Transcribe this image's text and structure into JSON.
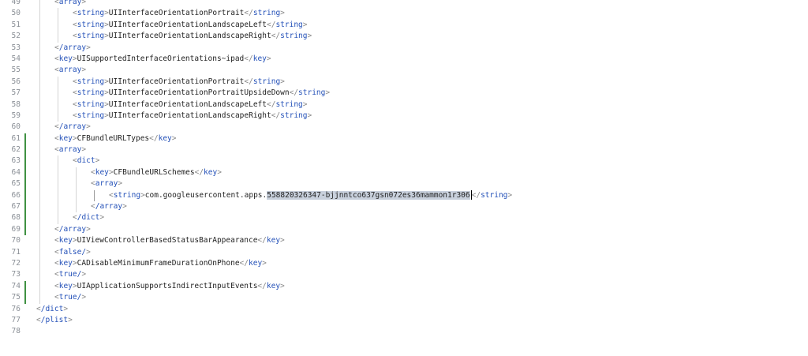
{
  "editor": {
    "lines": [
      {
        "number": "49",
        "indent": 1,
        "open": "array",
        "text": "",
        "close": "",
        "modified": false
      },
      {
        "number": "50",
        "indent": 2,
        "open": "string",
        "text": "UIInterfaceOrientationPortrait",
        "close": "string",
        "modified": false
      },
      {
        "number": "51",
        "indent": 2,
        "open": "string",
        "text": "UIInterfaceOrientationLandscapeLeft",
        "close": "string",
        "modified": false
      },
      {
        "number": "52",
        "indent": 2,
        "open": "string",
        "text": "UIInterfaceOrientationLandscapeRight",
        "close": "string",
        "modified": false
      },
      {
        "number": "53",
        "indent": 1,
        "open": "/array",
        "text": "",
        "close": "",
        "modified": false
      },
      {
        "number": "54",
        "indent": 1,
        "open": "key",
        "text": "UISupportedInterfaceOrientations~ipad",
        "close": "key",
        "modified": false
      },
      {
        "number": "55",
        "indent": 1,
        "open": "array",
        "text": "",
        "close": "",
        "modified": false
      },
      {
        "number": "56",
        "indent": 2,
        "open": "string",
        "text": "UIInterfaceOrientationPortrait",
        "close": "string",
        "modified": false
      },
      {
        "number": "57",
        "indent": 2,
        "open": "string",
        "text": "UIInterfaceOrientationPortraitUpsideDown",
        "close": "string",
        "modified": false
      },
      {
        "number": "58",
        "indent": 2,
        "open": "string",
        "text": "UIInterfaceOrientationLandscapeLeft",
        "close": "string",
        "modified": false
      },
      {
        "number": "59",
        "indent": 2,
        "open": "string",
        "text": "UIInterfaceOrientationLandscapeRight",
        "close": "string",
        "modified": false
      },
      {
        "number": "60",
        "indent": 1,
        "open": "/array",
        "text": "",
        "close": "",
        "modified": false
      },
      {
        "number": "61",
        "indent": 1,
        "open": "key",
        "text": "CFBundleURLTypes",
        "close": "key",
        "modified": true
      },
      {
        "number": "62",
        "indent": 1,
        "open": "array",
        "text": "",
        "close": "",
        "modified": true
      },
      {
        "number": "63",
        "indent": 2,
        "open": "dict",
        "text": "",
        "close": "",
        "modified": true
      },
      {
        "number": "64",
        "indent": 3,
        "open": "key",
        "text": "CFBundleURLSchemes",
        "close": "key",
        "modified": true
      },
      {
        "number": "65",
        "indent": 3,
        "open": "array",
        "text": "",
        "close": "",
        "modified": true
      },
      {
        "number": "66",
        "indent": 4,
        "open": "string",
        "text": "com.googleusercontent.apps.",
        "selected": "558820326347-bjjnntco637gsn072es36mammon1r306",
        "close": "string",
        "modified": true,
        "current": true
      },
      {
        "number": "67",
        "indent": 3,
        "open": "/array",
        "text": "",
        "close": "",
        "modified": true
      },
      {
        "number": "68",
        "indent": 2,
        "open": "/dict",
        "text": "",
        "close": "",
        "modified": true
      },
      {
        "number": "69",
        "indent": 1,
        "open": "/array",
        "text": "",
        "close": "",
        "modified": true
      },
      {
        "number": "70",
        "indent": 1,
        "open": "key",
        "text": "UIViewControllerBasedStatusBarAppearance",
        "close": "key",
        "modified": false
      },
      {
        "number": "71",
        "indent": 1,
        "open": "false/",
        "text": "",
        "close": "",
        "modified": false
      },
      {
        "number": "72",
        "indent": 1,
        "open": "key",
        "text": "CADisableMinimumFrameDurationOnPhone",
        "close": "key",
        "modified": false
      },
      {
        "number": "73",
        "indent": 1,
        "open": "true/",
        "text": "",
        "close": "",
        "modified": false
      },
      {
        "number": "74",
        "indent": 1,
        "open": "key",
        "text": "UIApplicationSupportsIndirectInputEvents",
        "close": "key",
        "modified": true
      },
      {
        "number": "75",
        "indent": 1,
        "open": "true/",
        "text": "",
        "close": "",
        "modified": true
      },
      {
        "number": "76",
        "indent": 0,
        "open": "/dict",
        "text": "",
        "close": "",
        "modified": false
      },
      {
        "number": "77",
        "indent": 0,
        "open": "/plist",
        "text": "",
        "close": "",
        "modified": false
      },
      {
        "number": "78",
        "indent": 0,
        "open": "",
        "text": "",
        "close": "",
        "modified": false
      }
    ]
  },
  "colors": {
    "tag": "#2350b8",
    "bracket": "#888888",
    "text": "#1f1f1f",
    "line_number": "#8a8f96",
    "modified_marker": "#3f9142",
    "selection": "#c8d0dc"
  }
}
